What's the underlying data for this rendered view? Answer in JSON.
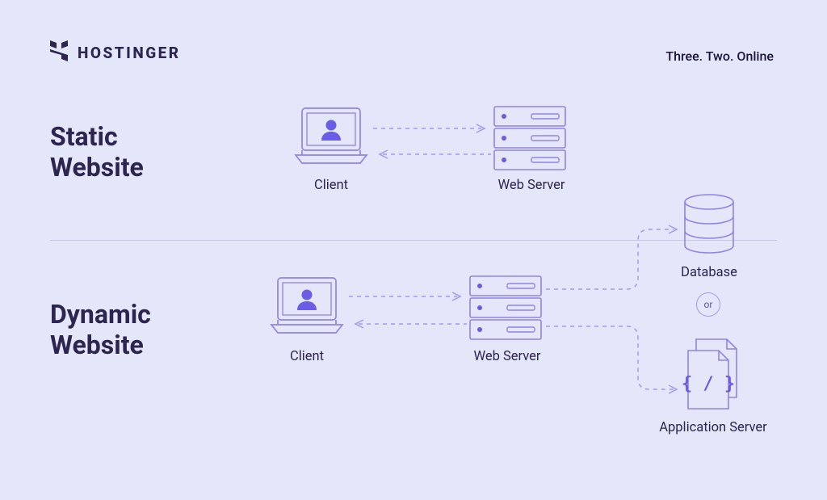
{
  "brand": {
    "name": "HOSTINGER"
  },
  "tagline": "Three. Two. Online",
  "sections": {
    "static_title_l1": "Static",
    "static_title_l2": "Website",
    "dynamic_title_l1": "Dynamic",
    "dynamic_title_l2": "Website"
  },
  "nodes": {
    "client": "Client",
    "web_server": "Web Server",
    "database": "Database",
    "application_server": "Application Server"
  },
  "connector_or": "or",
  "diagram": {
    "static": {
      "flow": [
        "Client",
        "Web Server"
      ],
      "bidirectional": true
    },
    "dynamic": {
      "flow": [
        "Client",
        "Web Server"
      ],
      "bidirectional": true,
      "server_branches": [
        "Database",
        "Application Server"
      ],
      "branch_relation": "or"
    }
  },
  "colors": {
    "background": "#e4e6f9",
    "ink": "#1a133d",
    "violet": "#6b5ce7",
    "violet_light": "#a29af0"
  }
}
